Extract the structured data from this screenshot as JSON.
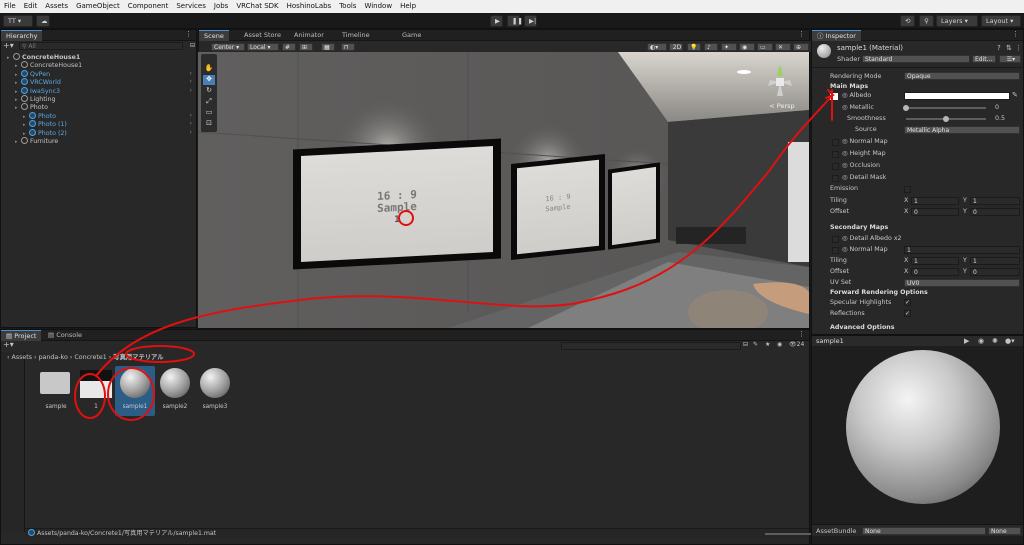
{
  "menu": [
    "File",
    "Edit",
    "Assets",
    "GameObject",
    "Component",
    "Services",
    "Jobs",
    "VRChat SDK",
    "HoshinoLabs",
    "Tools",
    "Window",
    "Help"
  ],
  "toolbar": {
    "account": "TT ▾",
    "layers": "Layers",
    "layout": "Layout"
  },
  "hierarchy": {
    "tab": "Hierarchy",
    "search_placeholder": "All",
    "items": [
      {
        "label": "ConcreteHouse1",
        "indent": 0,
        "bold": true,
        "blue": false
      },
      {
        "label": "ConcreteHouse1",
        "indent": 1,
        "bold": false,
        "blue": false
      },
      {
        "label": "QvPen",
        "indent": 1,
        "bold": false,
        "blue": true
      },
      {
        "label": "VRCWorld",
        "indent": 1,
        "bold": false,
        "blue": true
      },
      {
        "label": "IwaSync3",
        "indent": 1,
        "bold": false,
        "blue": true
      },
      {
        "label": "Lighting",
        "indent": 1,
        "bold": false,
        "blue": false
      },
      {
        "label": "Photo",
        "indent": 1,
        "bold": false,
        "blue": false
      },
      {
        "label": "Photo",
        "indent": 2,
        "bold": false,
        "blue": true
      },
      {
        "label": "Photo (1)",
        "indent": 2,
        "bold": false,
        "blue": true
      },
      {
        "label": "Photo (2)",
        "indent": 2,
        "bold": false,
        "blue": true
      },
      {
        "label": "Furniture",
        "indent": 1,
        "bold": false,
        "blue": false
      }
    ]
  },
  "scene_tabs": [
    "Scene",
    "Asset Store",
    "Animator",
    "Timeline",
    "Game"
  ],
  "scene_toolbar": {
    "pivot": "Center",
    "space": "Local",
    "mode2d": "2D"
  },
  "scene": {
    "persp_label": "< Persp",
    "poster_main": "16 : 9",
    "poster_sub": "Sample",
    "poster_num": "1",
    "poster2_main": "16 : 9",
    "poster2_sub": "Sample"
  },
  "project": {
    "tabs": [
      "Project",
      "Console"
    ],
    "breadcrumb": [
      "Assets",
      "panda-ko",
      "Concrete1",
      "写真用マテリアル"
    ],
    "count": "24",
    "assets": [
      {
        "label": "sample",
        "kind": "folder"
      },
      {
        "label": "1",
        "kind": "image"
      },
      {
        "label": "sample1",
        "kind": "material"
      },
      {
        "label": "sample2",
        "kind": "material"
      },
      {
        "label": "sample3",
        "kind": "material"
      }
    ],
    "status_path": "Assets/panda-ko/Concrete1/写真用マテリアル/sample1.mat"
  },
  "inspector": {
    "tab": "Inspector",
    "title": "sample1 (Material)",
    "shader_label": "Shader",
    "shader": "Standard",
    "edit": "Edit...",
    "rendering_mode_label": "Rendering Mode",
    "rendering_mode": "Opaque",
    "main_maps": "Main Maps",
    "albedo": "Albedo",
    "metallic": "Metallic",
    "metallic_value": "0",
    "smoothness": "Smoothness",
    "smoothness_value": "0.5",
    "smoothness_fraction": 0.5,
    "source_label": "Source",
    "source": "Metallic Alpha",
    "normal_map": "Normal Map",
    "height_map": "Height Map",
    "occlusion": "Occlusion",
    "detail_mask": "Detail Mask",
    "emission": "Emission",
    "tiling": "Tiling",
    "offset": "Offset",
    "tiling_x": "1",
    "tiling_y": "1",
    "offset_x": "0",
    "offset_y": "0",
    "secondary_maps": "Secondary Maps",
    "detail_albedo": "Detail Albedo x2",
    "normal_map2": "Normal Map",
    "normal_map2_value": "1",
    "tiling2_x": "1",
    "tiling2_y": "1",
    "offset2_x": "0",
    "offset2_y": "0",
    "uv_set_label": "UV Set",
    "uv_set": "UV0",
    "forward_options": "Forward Rendering Options",
    "specular_highlights": "Specular Highlights",
    "reflections": "Reflections",
    "advanced_options": "Advanced Options",
    "preview_name": "sample1",
    "assetbundle_label": "AssetBundle",
    "assetbundle": "None",
    "assetbundle_variant": "None"
  },
  "colors": {
    "annotation": "#e01010",
    "selection": "#2c5d87"
  }
}
